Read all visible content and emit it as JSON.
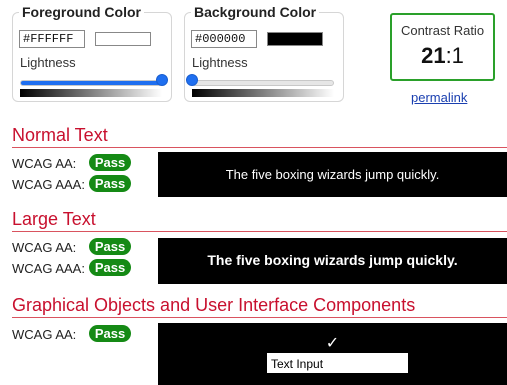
{
  "foreground": {
    "legend": "Foreground Color",
    "hex_value": "#FFFFFF",
    "swatch_color": "#FFFFFF",
    "lightness_label": "Lightness",
    "lightness_percent": 100
  },
  "background": {
    "legend": "Background Color",
    "hex_value": "#000000",
    "swatch_color": "#000000",
    "lightness_label": "Lightness",
    "lightness_percent": 0
  },
  "contrast": {
    "label": "Contrast Ratio",
    "value_main": "21",
    "value_suffix": ":1",
    "permalink_label": "permalink"
  },
  "normal_text": {
    "heading": "Normal Text",
    "aa_label": "WCAG AA:",
    "aa_result": "Pass",
    "aaa_label": "WCAG AAA:",
    "aaa_result": "Pass",
    "sample": "The five boxing wizards jump quickly."
  },
  "large_text": {
    "heading": "Large Text",
    "aa_label": "WCAG AA:",
    "aa_result": "Pass",
    "aaa_label": "WCAG AAA:",
    "aaa_result": "Pass",
    "sample": "The five boxing wizards jump quickly."
  },
  "graphical": {
    "heading": "Graphical Objects and User Interface Components",
    "aa_label": "WCAG AA:",
    "aa_result": "Pass",
    "check_icon": "check-icon",
    "check_glyph": "✓",
    "input_text": "Text Input"
  },
  "colors": {
    "pass_green": "#158a15",
    "heading_red": "#c8102e",
    "slider_blue": "#1f6ff0",
    "ratio_border_green": "#2aa02a"
  }
}
